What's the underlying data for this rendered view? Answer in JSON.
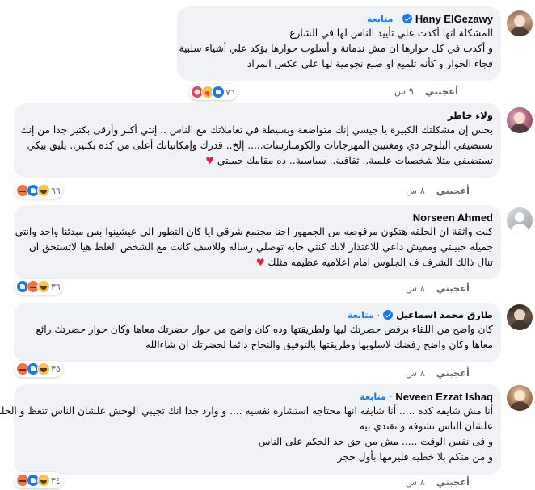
{
  "ui": {
    "like_label": "أعجبني",
    "follow_label": "متابعة",
    "separator": "·"
  },
  "comments": [
    {
      "author": "Hany ElGezawy",
      "verified": true,
      "following": true,
      "avatar": "avatar-photo",
      "lines": [
        "المشكلة انها أكدت علي تأييد الناس لها في الشارع",
        "و أكدت في كل حوارها ان مش ندمانة و أسلوب حوارها يؤكد علي أشياء سلبية",
        "فجاء الحوار و كأنه تلميع او صنع نجومية لها علي عكس المراد"
      ],
      "reaction_icons": [
        "like-icon",
        "care-icon",
        "love-icon"
      ],
      "reaction_count": "٧٦",
      "time": "٩ س"
    },
    {
      "author": "ولاء خاطر",
      "verified": false,
      "following": false,
      "avatar": "avatar-photo",
      "lines": [
        "بحس إن مشكلتك الكبيرة يا جيسي إنك متواضعة وبسيطة في تعاملاتك مع الناس .. إنتي أكبر وأرقى بكتير جدا من إنك",
        "تستضيفي البلوجر دي ومغنيين المهرجانات والكومبارسات..... إلخ.. قدرك وإمكانياتك أعلى من كده بكتير.. يليق بيكي",
        "تستضيفي مثلا شخصيات علمية.. ثقافية.. سياسية.. ده مقامك حبيبتي"
      ],
      "heart": "♥",
      "reaction_icons": [
        "haha-icon",
        "like-icon",
        "angry-icon"
      ],
      "reaction_count": "٦٦",
      "time": "٨ س"
    },
    {
      "author": "Norseen Ahmed",
      "verified": false,
      "following": false,
      "avatar": "default-avatar",
      "lines": [
        "كنت واثقة ان الحلقه هتكون مرفوضه من الجمهور احنا مجتمع شرقي ايا كان التطور الي عيشينوا بس مبدئنا واحد وانتي",
        "جميله حبيبتي ومفيش داعي للاعتذار لانك كنتي حابه توصلي رساله وللاسف كانت مع الشخص الغلط هيا لاتستحق ان",
        "تنال ذالك الشرف ف الجلوس امام اعلاميه عظيمه مثلك"
      ],
      "heart": "♥",
      "reaction_icons": [
        "haha-icon",
        "angry-icon",
        "like-icon"
      ],
      "reaction_count": "٣٦",
      "time": "٨ س"
    },
    {
      "author": "طارق محمد اسماعيل",
      "verified": true,
      "following": true,
      "avatar": "avatar-photo",
      "lines": [
        "كان واضح من اللقاء برفض حضرتك ليها ولطريقتها وده كان واضح من حوار حضرتك معاها وكان حوار حضرتك رائع",
        "معاها وكان واضح رفضك لاسلوبها وطريقتها بالتوفيق والنجاح دائما لحضرتك ان شاءالله"
      ],
      "reaction_icons": [
        "haha-icon",
        "like-icon",
        "angry-icon"
      ],
      "reaction_count": "٣٥",
      "time": "٨ س"
    },
    {
      "author": "Neveen Ezzat Ishaq",
      "verified": false,
      "following": true,
      "avatar": "avatar-photo",
      "lines": [
        "أنا مش شايفه كده ..... أنا شايفه انها محتاجه استشاره نفسيه .... و وارد جدا انك تجيبي الوحش علشان الناس تتعظ و الحلو",
        "علشان الناس تشوفه و تقتدي بيه",
        "و فى نفس الوقت ..... مش من حق حد الحكم على الناس",
        "و من منكم بلا خطيه فليرمها بأول حجر"
      ],
      "reaction_icons": [
        "haha-icon",
        "like-icon",
        "angry-icon"
      ],
      "reaction_count": "٣٤",
      "time": "٨ س"
    }
  ]
}
